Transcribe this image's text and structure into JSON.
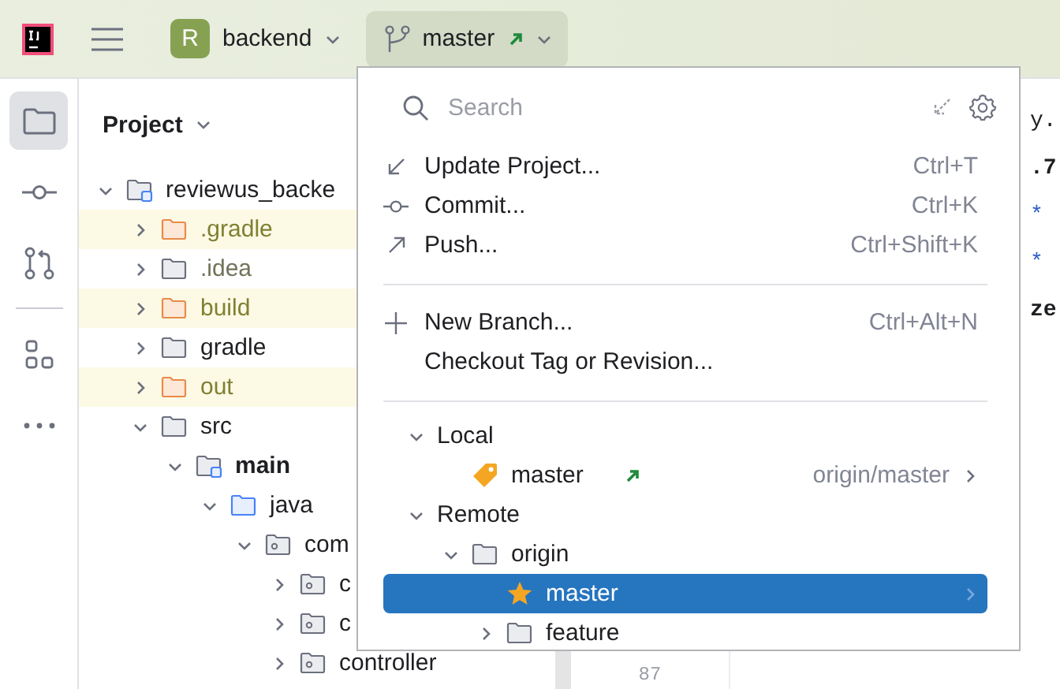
{
  "toolbar": {
    "project": {
      "badge": "R",
      "name": "backend"
    },
    "branch": {
      "name": "master",
      "outgoing": true,
      "pressed": true
    }
  },
  "tool_strip": [
    {
      "kind": "folder",
      "selected": true
    },
    {
      "kind": "commit",
      "selected": false
    },
    {
      "kind": "pull-requests",
      "selected": false
    },
    {
      "kind": "structure",
      "selected": false
    },
    {
      "kind": "more",
      "selected": false
    }
  ],
  "project_panel": {
    "title": "Project",
    "tree": [
      {
        "label": "reviewus_backe",
        "kind": "module",
        "expanded": true,
        "children": [
          {
            "label": ".gradle",
            "kind": "folder",
            "expanded": false,
            "excluded": true
          },
          {
            "label": ".idea",
            "kind": "folder",
            "expanded": false,
            "ignored": true
          },
          {
            "label": "build",
            "kind": "folder",
            "expanded": false,
            "excluded": true
          },
          {
            "label": "gradle",
            "kind": "folder",
            "expanded": false
          },
          {
            "label": "out",
            "kind": "folder",
            "expanded": false,
            "excluded": true
          },
          {
            "label": "src",
            "kind": "folder",
            "expanded": true,
            "children": [
              {
                "label": "main",
                "kind": "module",
                "expanded": true,
                "bold": true,
                "children": [
                  {
                    "label": "java",
                    "kind": "source",
                    "expanded": true,
                    "children": [
                      {
                        "label": "com",
                        "kind": "package",
                        "expanded": true,
                        "children": [
                          {
                            "label": "c",
                            "kind": "package",
                            "expanded": false
                          },
                          {
                            "label": "c",
                            "kind": "package",
                            "expanded": false
                          },
                          {
                            "label": "controller",
                            "kind": "package",
                            "expanded": false
                          }
                        ]
                      }
                    ]
                  }
                ]
              }
            ]
          }
        ]
      }
    ]
  },
  "editor": {
    "fragments": [
      {
        "text": "y.",
        "kind": "plain"
      },
      {
        "text": ".7",
        "kind": "bold"
      },
      {
        "text": "*",
        "kind": "doc"
      },
      {
        "text": "*",
        "kind": "doc"
      },
      {
        "text": "ze",
        "kind": "bold"
      }
    ],
    "line_number": "87"
  },
  "branch_popup": {
    "search": {
      "placeholder": "Search"
    },
    "action_groups": [
      [
        {
          "label": "Update Project...",
          "kind": "update",
          "shortcut": "Ctrl+T"
        },
        {
          "label": "Commit...",
          "kind": "commit",
          "shortcut": "Ctrl+K"
        },
        {
          "label": "Push...",
          "kind": "push",
          "shortcut": "Ctrl+Shift+K"
        }
      ],
      [
        {
          "label": "New Branch...",
          "kind": "new",
          "shortcut": "Ctrl+Alt+N"
        },
        {
          "label": "Checkout Tag or Revision...",
          "kind": "checkout"
        }
      ]
    ],
    "branches": [
      {
        "label": "Local",
        "kind": "group",
        "expanded": true,
        "selected": false,
        "children": [
          {
            "label": "master",
            "kind": "branch",
            "current": true,
            "outgoing": true,
            "tracking": "origin/master",
            "selected": false
          }
        ]
      },
      {
        "label": "Remote",
        "kind": "group",
        "expanded": true,
        "selected": false,
        "children": [
          {
            "label": "origin",
            "kind": "remote",
            "expanded": true,
            "selected": false,
            "children": [
              {
                "label": "master",
                "kind": "branch",
                "favorite": true,
                "selected": true
              },
              {
                "label": "feature",
                "kind": "remote",
                "expanded": false,
                "selected": false
              }
            ]
          }
        ]
      }
    ]
  }
}
